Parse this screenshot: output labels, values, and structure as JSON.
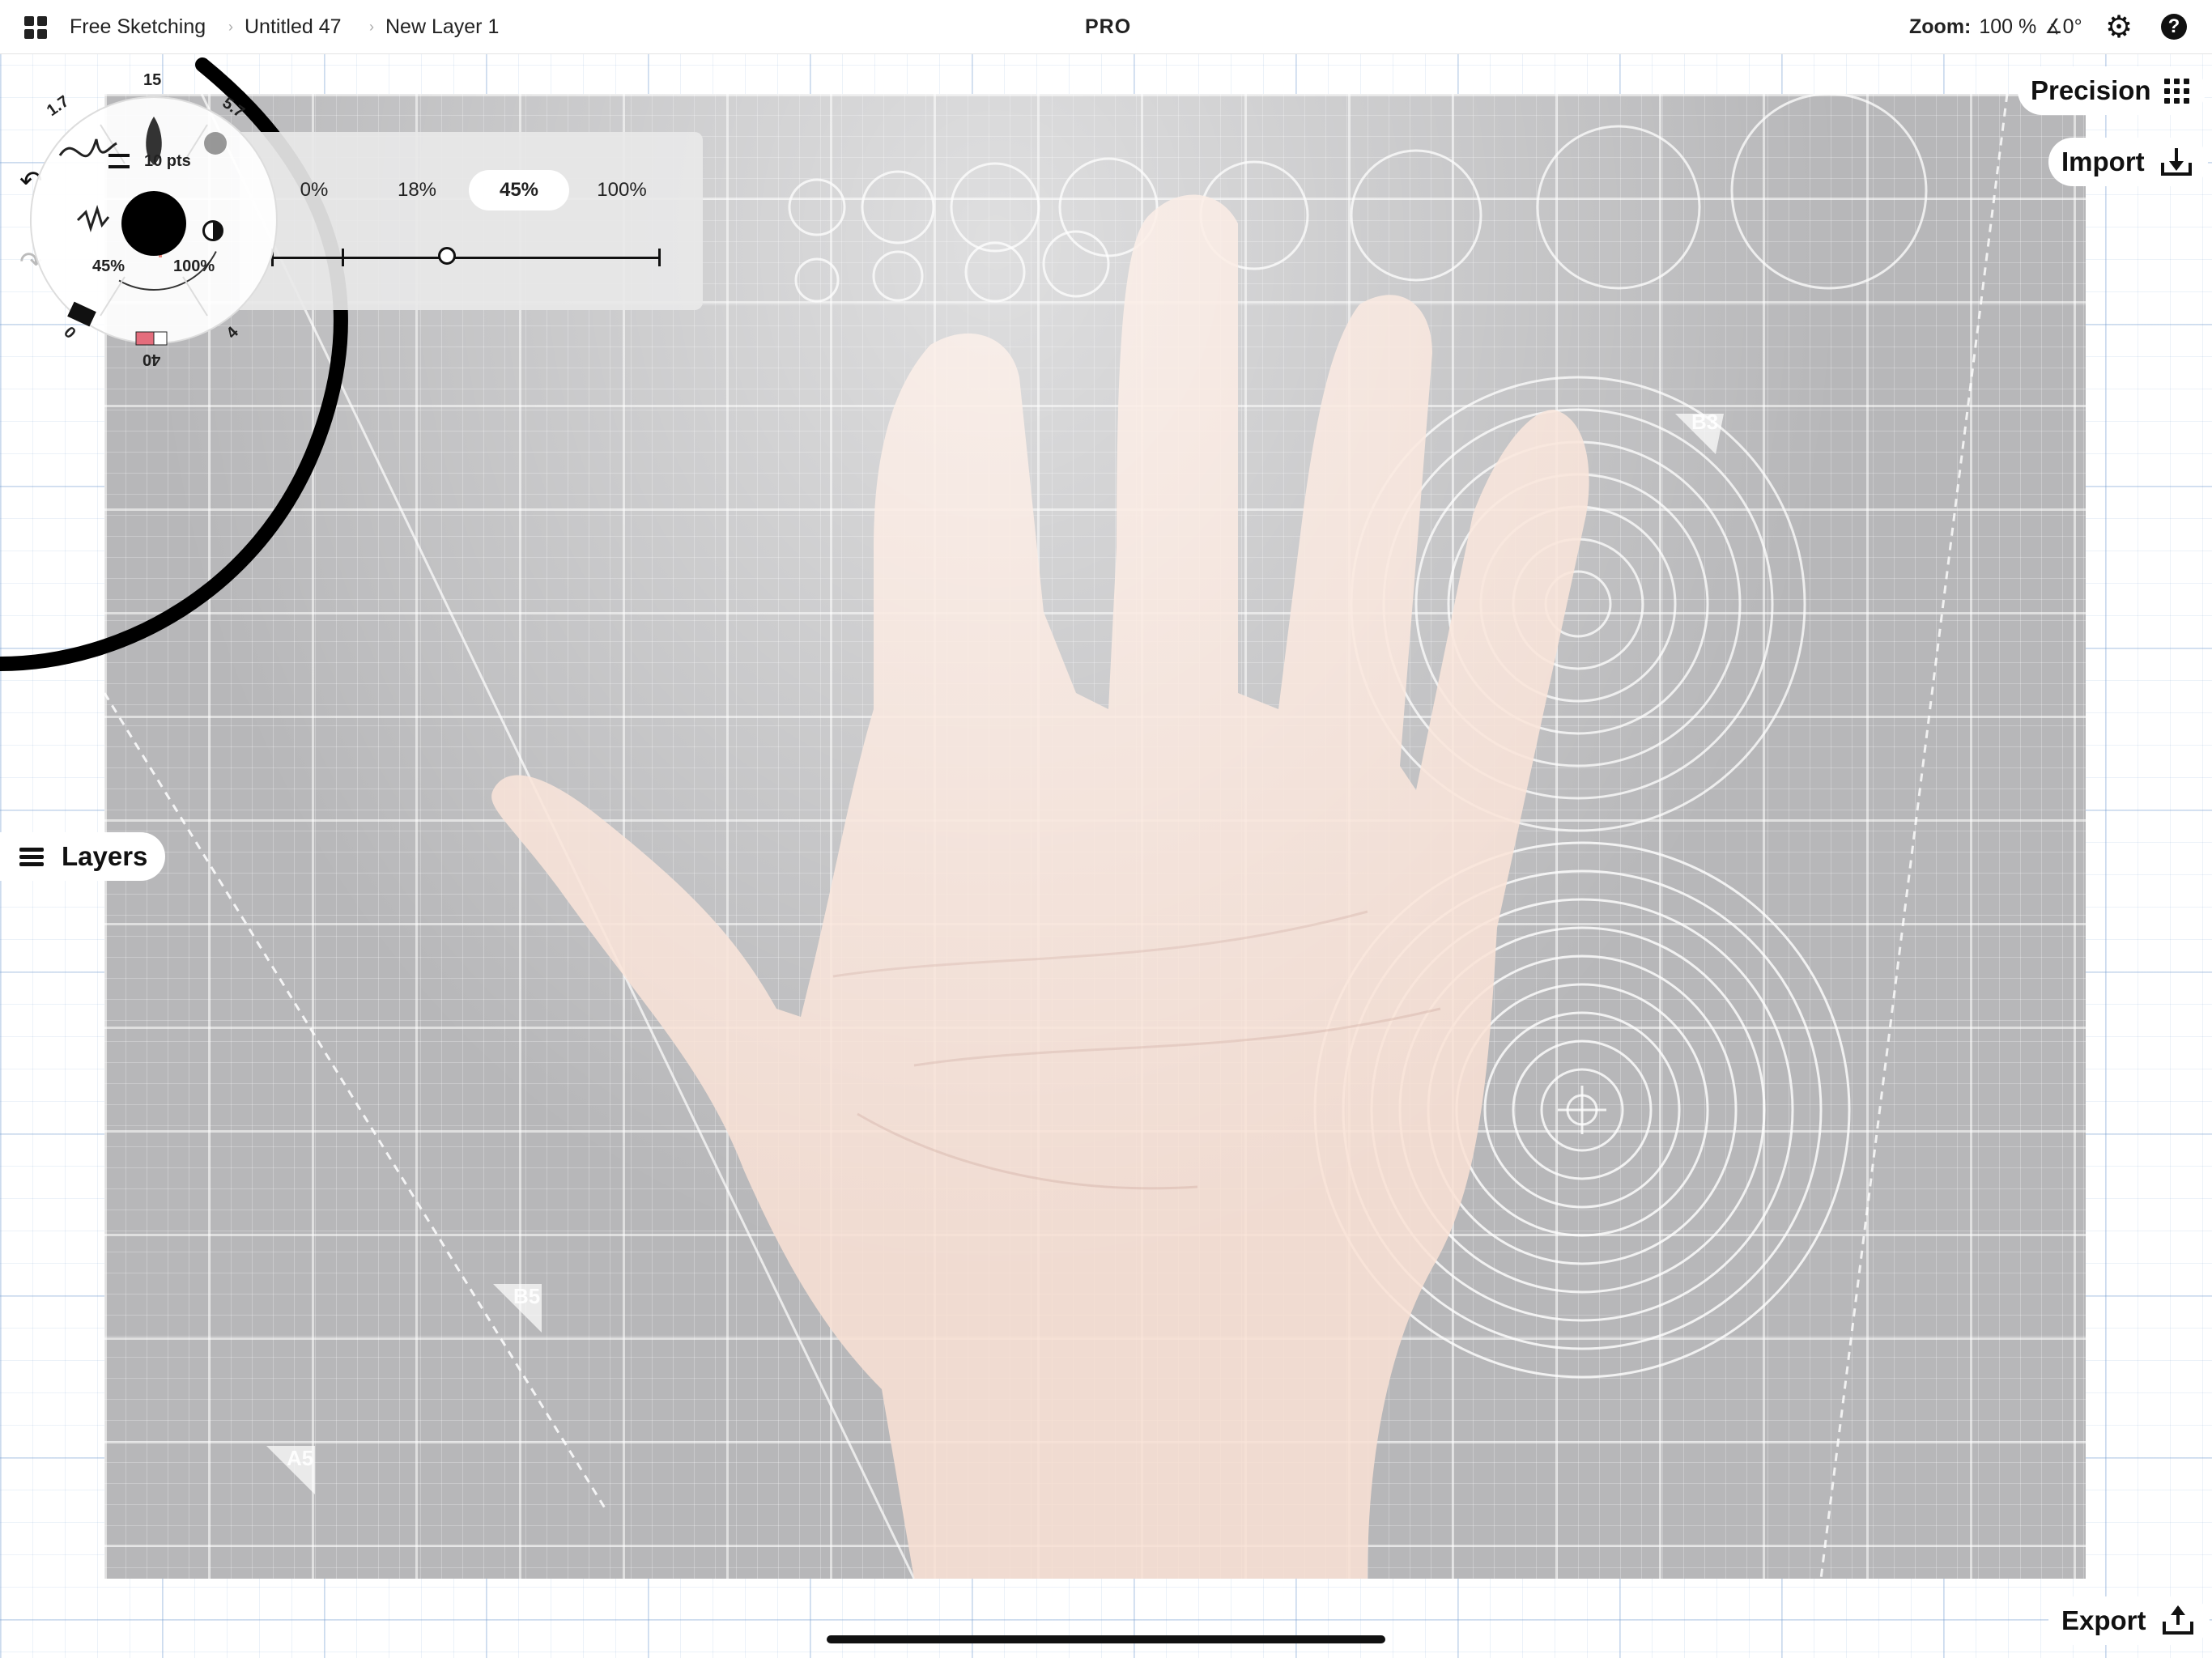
{
  "topbar": {
    "app_name": "Free Sketching",
    "document": "Untitled 47",
    "layer": "New Layer 1",
    "badge": "PRO",
    "zoom_label": "Zoom:",
    "zoom_value": "100 %",
    "rotation_value": "∡0°",
    "help_glyph": "?"
  },
  "brush_wheel": {
    "size_label": "10 pts",
    "brush_sizes": [
      "1.7",
      "15",
      "5.7",
      "4",
      "40",
      "0"
    ],
    "opacity_value": "45%",
    "contrast_value": "100%",
    "color": "#000000"
  },
  "opacity_panel": {
    "presets": [
      "0%",
      "18%",
      "45%",
      "100%"
    ],
    "selected_index": 2,
    "slider_value": 0.45
  },
  "side": {
    "precision_label": "Precision",
    "import_label": "Import",
    "layers_label": "Layers",
    "export_label": "Export"
  },
  "canvas": {
    "mat_labels": [
      "B3",
      "B5",
      "A5"
    ]
  },
  "icons": {
    "menu": "grid-icon",
    "settings": "gear-icon",
    "help": "help-icon",
    "undo": "undo-icon",
    "redo": "redo-icon",
    "precision": "dots-grid-icon",
    "import": "import-icon",
    "layers": "layers-icon",
    "export": "export-icon"
  }
}
